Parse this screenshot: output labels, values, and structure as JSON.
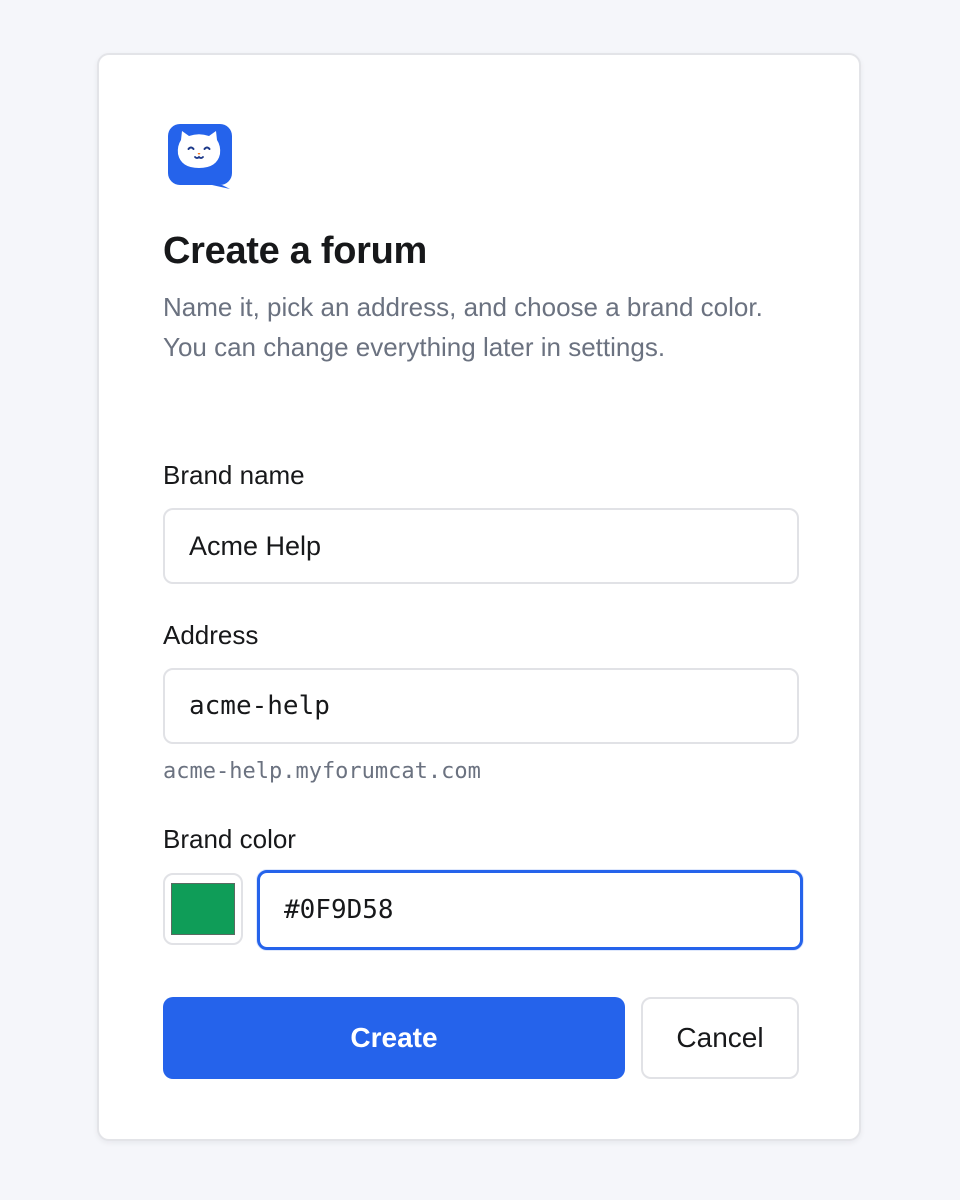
{
  "logo": {
    "icon": "cat-chat-logo-icon",
    "color": "#2563eb"
  },
  "title": "Create a forum",
  "subtitle": "Name it, pick an address, and choose a brand color. You can change everything later in settings.",
  "brand_name": {
    "label": "Brand name",
    "value": "Acme Help"
  },
  "address": {
    "label": "Address",
    "value": "acme-help",
    "hint": "acme-help.myforumcat.com"
  },
  "brand_color": {
    "label": "Brand color",
    "swatch": "#0F9D58",
    "value": "#0F9D58"
  },
  "actions": {
    "create_label": "Create",
    "cancel_label": "Cancel",
    "primary_color": "#2563eb"
  }
}
